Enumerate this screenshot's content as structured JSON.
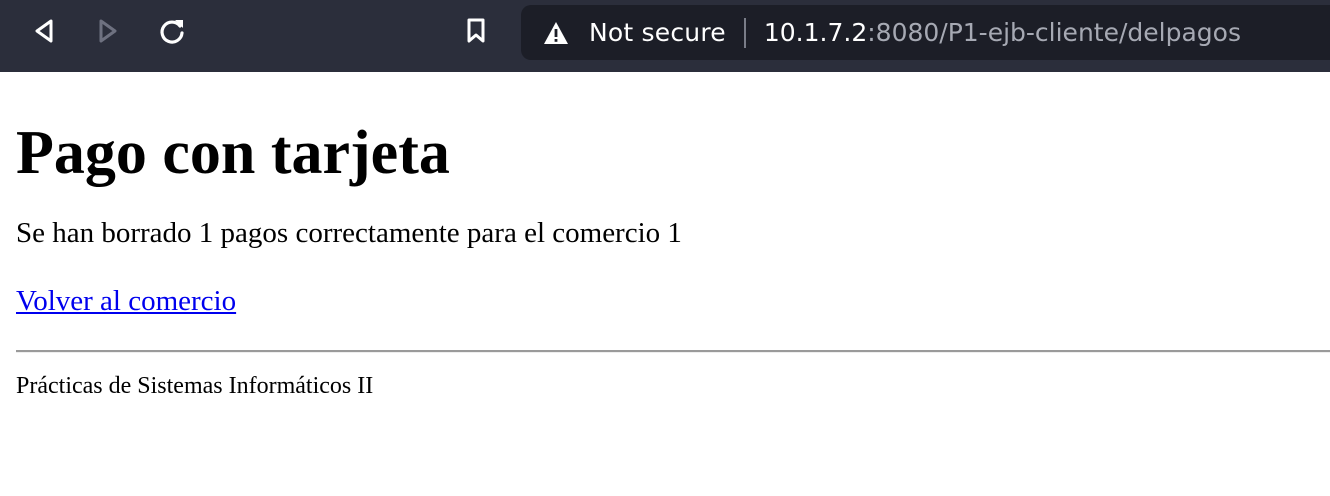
{
  "browser": {
    "security_label": "Not secure",
    "url_host": "10.1.7.2",
    "url_rest": ":8080/P1-ejb-cliente/delpagos",
    "icons": {
      "back": "back-arrow-icon",
      "forward": "forward-arrow-icon",
      "reload": "reload-icon",
      "bookmark": "bookmark-icon",
      "warning": "warning-triangle-icon"
    },
    "colors": {
      "toolbar": "#2b2e3b",
      "omnibox": "#1c1e27",
      "url_dim": "#a6a9b3"
    }
  },
  "page": {
    "title": "Pago con tarjeta",
    "message": "Se han borrado 1 pagos correctamente para el comercio 1",
    "back_link": "Volver al comercio",
    "footer": "Prácticas de Sistemas Informáticos II",
    "link_color": "#0000ee"
  }
}
